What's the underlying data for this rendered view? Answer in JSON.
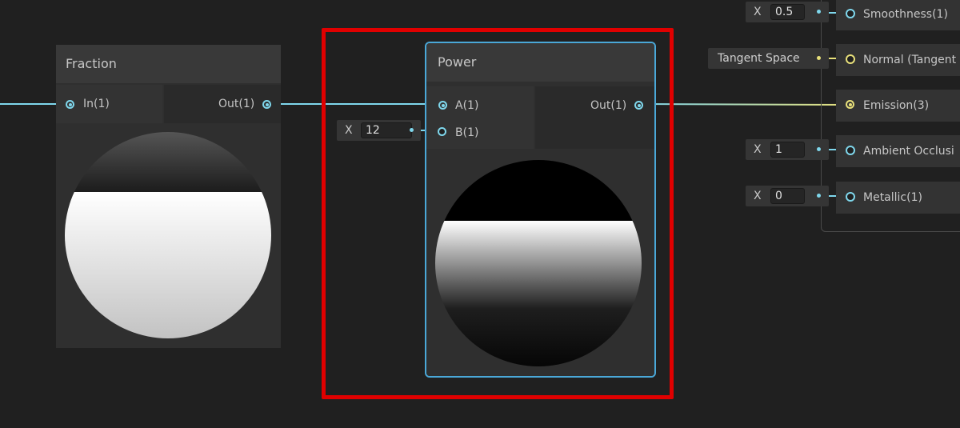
{
  "fraction_node": {
    "title": "Fraction",
    "input_label": "In(1)",
    "output_label": "Out(1)"
  },
  "power_node": {
    "title": "Power",
    "input_a_label": "A(1)",
    "input_b_label": "B(1)",
    "output_label": "Out(1)",
    "b_field": {
      "axis": "X",
      "value": "12"
    }
  },
  "master_node": {
    "inputs": [
      {
        "label": "Smoothness(1)",
        "field_axis": "X",
        "field_value": "0.5",
        "port_color": "#7fd7ec"
      },
      {
        "label": "Normal (Tangent",
        "field_text": "Tangent Space",
        "port_color": "#e8e07a"
      },
      {
        "label": "Emission(3)",
        "port_color": "#e8e07a"
      },
      {
        "label": "Ambient Occlusi",
        "field_axis": "X",
        "field_value": "1",
        "port_color": "#7fd7ec"
      },
      {
        "label": "Metallic(1)",
        "field_axis": "X",
        "field_value": "0",
        "port_color": "#7fd7ec"
      }
    ]
  },
  "colors": {
    "background": "#202020",
    "wire_float": "#7fd7ec",
    "wire_vector": "#e8e07a",
    "selection": "#4aa8d8",
    "highlight": "#e00000"
  }
}
